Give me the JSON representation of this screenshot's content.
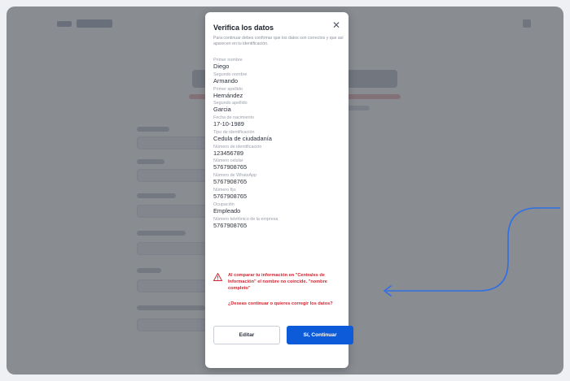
{
  "modal": {
    "title": "Verifica los datos",
    "description": "Para continuar debes confirmar que los datos son correctos y que así aparecen en tu identificación.",
    "fields": [
      {
        "label": "Primer nombre",
        "value": "Diego"
      },
      {
        "label": "Segundo nombre",
        "value": "Armando"
      },
      {
        "label": "Primer apellido",
        "value": "Hernández"
      },
      {
        "label": "Segundo apellido",
        "value": "Garcia"
      },
      {
        "label": "Fecha de nacimiento",
        "value": "17-10-1989"
      },
      {
        "label": "Tipo de identificación",
        "value": "Cedula de ciudadanía"
      },
      {
        "label": "Número de identificación",
        "value": "123456789"
      },
      {
        "label": "Número celular",
        "value": "5767908765"
      },
      {
        "label": "Número de WhatsApp",
        "value": "5767908765"
      },
      {
        "label": "Número fijo",
        "value": "5767908765"
      },
      {
        "label": "Ocupación",
        "value": "Empleado"
      },
      {
        "label": "Número telefónico de la empresa",
        "value": "5767908765"
      }
    ],
    "warning": "Al comparar tu información en \"Centrales de Información\" el nombre no coincide. \"nombre completo\"",
    "question": "¿Deseas continuar o quieres corregir los datos?",
    "edit_label": "Editar",
    "continue_label": "Sí, Continuar",
    "close_icon": "close-icon",
    "warning_icon": "warning-triangle-icon"
  },
  "colors": {
    "primary": "#0d5bd8",
    "error": "#d22630",
    "overlay": "#282d37",
    "annotation_arrow": "#2f6fe6"
  }
}
